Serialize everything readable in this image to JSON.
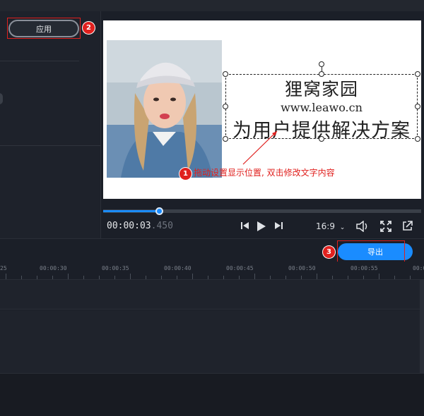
{
  "left_panel": {
    "apply_label": "应用"
  },
  "preview": {
    "title_line1": "狸窝家园",
    "title_line2": "www.leawo.cn",
    "title_line3": "为用户提供解决方案",
    "annotation": "拖动设置显示位置, 双击修改文字内容"
  },
  "playback": {
    "time_main": "00:00:03",
    "time_ms": ".450",
    "progress": 0.18,
    "aspect_ratio": "16:9",
    "icons": [
      "skip-back-icon",
      "play-icon",
      "skip-forward-icon",
      "volume-icon",
      "fullscreen-icon",
      "popout-icon"
    ]
  },
  "toolbar": {
    "export_label": "导出"
  },
  "timeline": {
    "ticks": [
      "25",
      "00:00:30",
      "00:00:35",
      "00:00:40",
      "00:00:45",
      "00:00:50",
      "00:00:55",
      "00:0"
    ]
  },
  "callouts": [
    "1",
    "2",
    "3"
  ],
  "colors": {
    "accent": "#1a8cff",
    "annotation_red": "#e0201e",
    "background": "#1b1f28"
  }
}
